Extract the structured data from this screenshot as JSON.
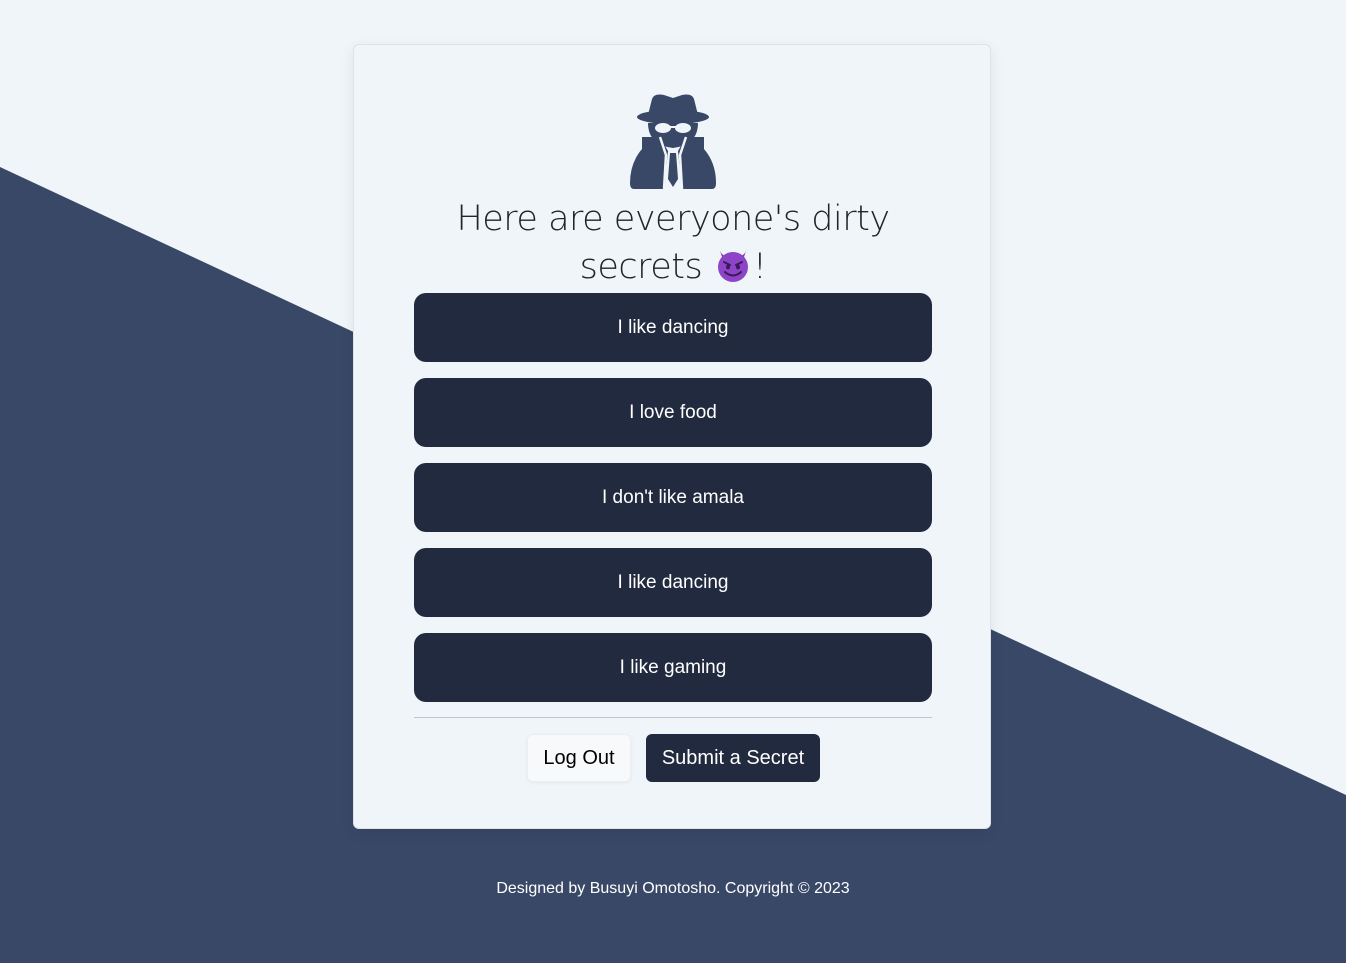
{
  "heading": {
    "line1": "Here are everyone's dirty",
    "line2_text": "secrets ",
    "emoji": "devil-emoji",
    "line2_end": "!"
  },
  "secrets": [
    {
      "text": "I like dancing"
    },
    {
      "text": "I love food"
    },
    {
      "text": "I don't like amala"
    },
    {
      "text": "I like dancing"
    },
    {
      "text": "I like gaming"
    }
  ],
  "buttons": {
    "logout_label": "Log Out",
    "submit_label": "Submit a Secret"
  },
  "footer": {
    "text": "Designed by Busuyi Omotosho. Copyright © 2023"
  },
  "colors": {
    "background_light": "#f0f5f9",
    "background_dark": "#394867",
    "item_bg": "#212a3e",
    "icon": "#394867"
  },
  "icons": {
    "hero": "user-secret-icon"
  }
}
